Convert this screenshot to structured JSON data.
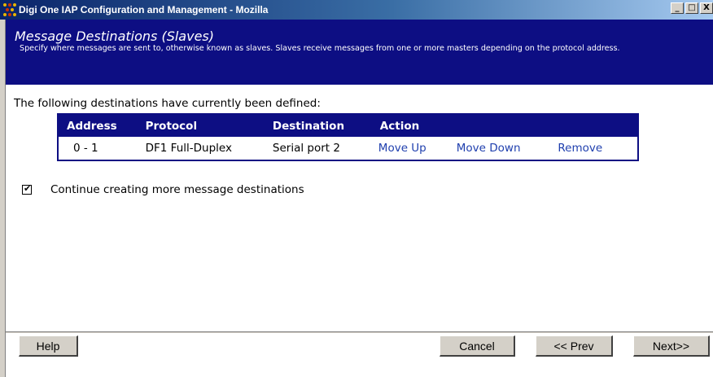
{
  "window": {
    "title": "Digi One IAP Configuration and Management - Mozilla",
    "minimize": "_",
    "maximize": "□",
    "close": "X"
  },
  "header": {
    "title": "Message Destinations (Slaves)",
    "description": "Specify where messages are sent to, otherwise known as slaves. Slaves receive messages from one or more masters depending on the protocol address."
  },
  "main": {
    "intro": "The following destinations have currently been defined:",
    "table": {
      "headers": [
        "Address",
        "Protocol",
        "Destination",
        "Action"
      ],
      "rows": [
        {
          "address": "0 - 1",
          "protocol": "DF1 Full-Duplex",
          "destination": "Serial port 2",
          "actions": [
            "Move Up",
            "Move Down",
            "Remove"
          ]
        }
      ]
    },
    "continue_checkbox": {
      "checked": true,
      "label": "Continue creating more message destinations"
    }
  },
  "footer": {
    "help": "Help",
    "cancel": "Cancel",
    "prev": "<< Prev",
    "next": "Next>>"
  },
  "colors": {
    "header_bg": "#0d0e83",
    "link": "#1f3fae",
    "button_face": "#d4d0c8"
  }
}
